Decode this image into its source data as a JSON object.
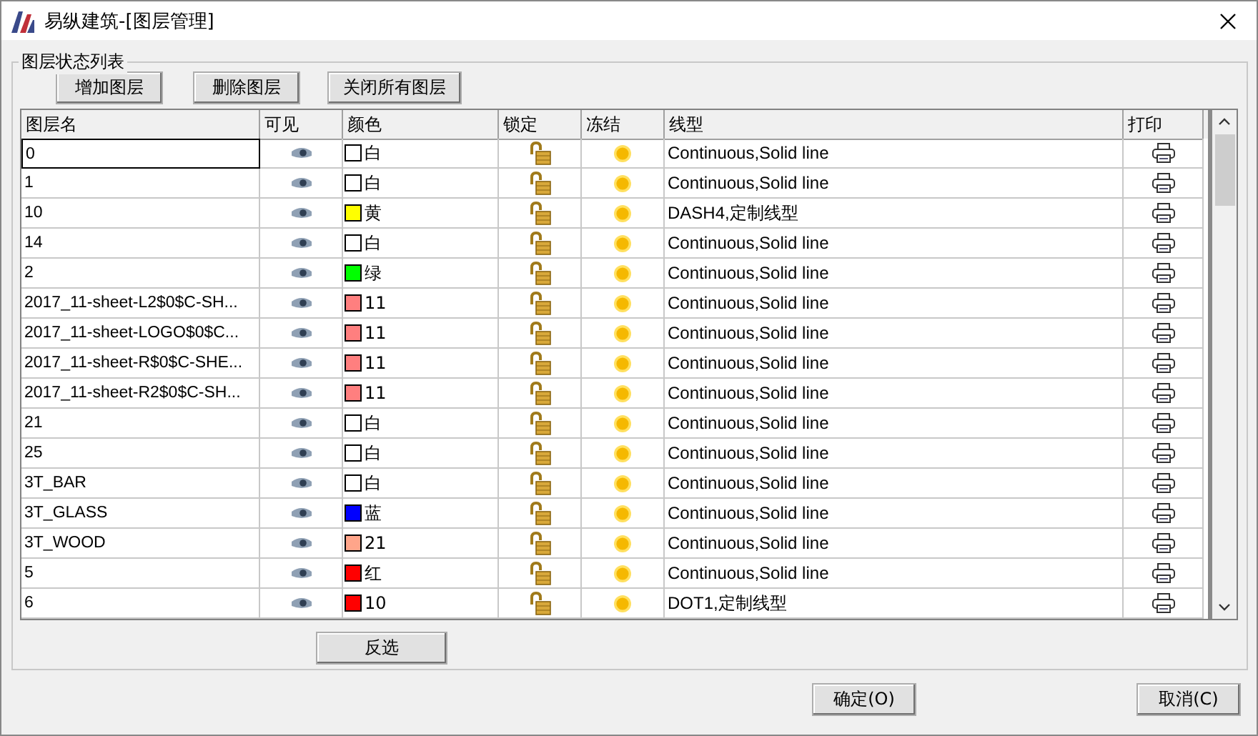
{
  "window": {
    "title": "易纵建筑-[图层管理]"
  },
  "group": {
    "title": "图层状态列表"
  },
  "toolbar": [
    "增加图层",
    "删除图层",
    "关闭所有图层"
  ],
  "table": {
    "columns": [
      "图层名",
      "可见",
      "颜色",
      "锁定",
      "冻结",
      "线型",
      "打印"
    ],
    "rows": [
      {
        "name": "0",
        "focused": true,
        "visible": true,
        "color": "#ffffff",
        "color_name": "白",
        "locked": false,
        "frozen": false,
        "linetype": "Continuous,Solid line",
        "printable": true
      },
      {
        "name": "1",
        "focused": false,
        "visible": true,
        "color": "#ffffff",
        "color_name": "白",
        "locked": false,
        "frozen": false,
        "linetype": "Continuous,Solid line",
        "printable": true
      },
      {
        "name": "10",
        "focused": false,
        "visible": true,
        "color": "#ffff00",
        "color_name": "黄",
        "locked": false,
        "frozen": false,
        "linetype": "DASH4,定制线型",
        "printable": true
      },
      {
        "name": "14",
        "focused": false,
        "visible": true,
        "color": "#ffffff",
        "color_name": "白",
        "locked": false,
        "frozen": false,
        "linetype": "Continuous,Solid line",
        "printable": true
      },
      {
        "name": "2",
        "focused": false,
        "visible": true,
        "color": "#00ff00",
        "color_name": "绿",
        "locked": false,
        "frozen": false,
        "linetype": "Continuous,Solid line",
        "printable": true
      },
      {
        "name": "2017_11-sheet-L2$0$C-SH...",
        "focused": false,
        "visible": true,
        "color": "#ff7f7f",
        "color_name": "11",
        "locked": false,
        "frozen": false,
        "linetype": "Continuous,Solid line",
        "printable": true
      },
      {
        "name": "2017_11-sheet-LOGO$0$C...",
        "focused": false,
        "visible": true,
        "color": "#ff7f7f",
        "color_name": "11",
        "locked": false,
        "frozen": false,
        "linetype": "Continuous,Solid line",
        "printable": true
      },
      {
        "name": "2017_11-sheet-R$0$C-SHE...",
        "focused": false,
        "visible": true,
        "color": "#ff7f7f",
        "color_name": "11",
        "locked": false,
        "frozen": false,
        "linetype": "Continuous,Solid line",
        "printable": true
      },
      {
        "name": "2017_11-sheet-R2$0$C-SH...",
        "focused": false,
        "visible": true,
        "color": "#ff7f7f",
        "color_name": "11",
        "locked": false,
        "frozen": false,
        "linetype": "Continuous,Solid line",
        "printable": true
      },
      {
        "name": "21",
        "focused": false,
        "visible": true,
        "color": "#ffffff",
        "color_name": "白",
        "locked": false,
        "frozen": false,
        "linetype": "Continuous,Solid line",
        "printable": true
      },
      {
        "name": "25",
        "focused": false,
        "visible": true,
        "color": "#ffffff",
        "color_name": "白",
        "locked": false,
        "frozen": false,
        "linetype": "Continuous,Solid line",
        "printable": true
      },
      {
        "name": "3T_BAR",
        "focused": false,
        "visible": true,
        "color": "#ffffff",
        "color_name": "白",
        "locked": false,
        "frozen": false,
        "linetype": "Continuous,Solid line",
        "printable": true
      },
      {
        "name": "3T_GLASS",
        "focused": false,
        "visible": true,
        "color": "#0000ff",
        "color_name": "蓝",
        "locked": false,
        "frozen": false,
        "linetype": "Continuous,Solid line",
        "printable": true
      },
      {
        "name": "3T_WOOD",
        "focused": false,
        "visible": true,
        "color": "#ffa58a",
        "color_name": "21",
        "locked": false,
        "frozen": false,
        "linetype": "Continuous,Solid line",
        "printable": true
      },
      {
        "name": "5",
        "focused": false,
        "visible": true,
        "color": "#ff0000",
        "color_name": "红",
        "locked": false,
        "frozen": false,
        "linetype": "Continuous,Solid line",
        "printable": true
      },
      {
        "name": "6",
        "focused": false,
        "visible": true,
        "color": "#ff0000",
        "color_name": "10",
        "locked": false,
        "frozen": false,
        "linetype": "DOT1,定制线型",
        "printable": true
      }
    ]
  },
  "invert_button": "反选",
  "buttons": [
    "确定(O)",
    "取消(C)"
  ]
}
